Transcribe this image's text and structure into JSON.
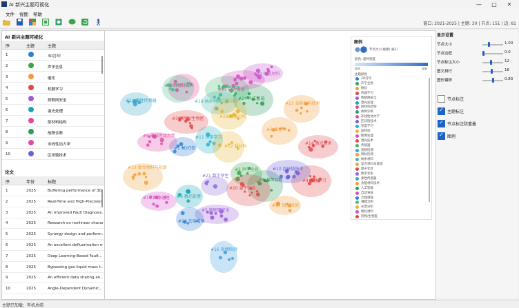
{
  "window": {
    "title": "AI 新兴主题可视化",
    "controls": {
      "minimize": "—",
      "maximize": "□",
      "close": "✕"
    }
  },
  "menu": [
    "文件",
    "视图",
    "帮助"
  ],
  "toolbar": {
    "status": "窗口: 2021-2025 | 主题: 30 | 节点: 151 | 边: 81"
  },
  "topics_panel": {
    "title": "AI 新兴主题可视化",
    "headers": [
      "序",
      "主题",
      "主题"
    ],
    "rows": [
      {
        "id": "1",
        "color": "#2f7fd4",
        "label": "3D打印"
      },
      {
        "id": "2",
        "color": "#3aa64b",
        "label": "声学全息"
      },
      {
        "id": "3",
        "color": "#f29b38",
        "label": "催化"
      },
      {
        "id": "4",
        "color": "#e04848",
        "label": "机器学习"
      },
      {
        "id": "5",
        "color": "#9a5ed6",
        "label": "物联网安全"
      },
      {
        "id": "6",
        "color": "#1aa6b8",
        "label": "激光处理"
      },
      {
        "id": "7",
        "color": "#e8439a",
        "label": "耐材料结构"
      },
      {
        "id": "8",
        "color": "#2a9d59",
        "label": "故障诊断"
      },
      {
        "id": "9",
        "color": "#e04ca8",
        "label": "非线性动力学"
      },
      {
        "id": "10",
        "color": "#6b62d8",
        "label": "区块链技术"
      }
    ]
  },
  "papers_panel": {
    "title": "论文",
    "headers": [
      "序",
      "年份",
      "标题"
    ],
    "rows": [
      {
        "id": "1",
        "year": "2025",
        "title": "Buffering performance of 3D..."
      },
      {
        "id": "2",
        "year": "2025",
        "title": "Real-Time and High-Precision..."
      },
      {
        "id": "3",
        "year": "2025",
        "title": "An Improved Fault Diagnosis..."
      },
      {
        "id": "4",
        "year": "2025",
        "title": "Research on nonlinear charac..."
      },
      {
        "id": "5",
        "year": "2025",
        "title": "Synergy design and perform..."
      },
      {
        "id": "6",
        "year": "2025",
        "title": "An excellent defluorination m..."
      },
      {
        "id": "7",
        "year": "2025",
        "title": "Deep Learning-Based Fault..."
      },
      {
        "id": "8",
        "year": "2025",
        "title": "Bypassing gas-liquid mass t..."
      },
      {
        "id": "9",
        "year": "2025",
        "title": "An efficient data sharing an..."
      },
      {
        "id": "10",
        "year": "2025",
        "title": "Angle-Dependent Dynamic..."
      }
    ]
  },
  "graph": {
    "clusters": [
      {
        "label": "#1 3D打印",
        "color": "#2f7fd4"
      },
      {
        "label": "#2 声学全息",
        "color": "#3aa64b"
      },
      {
        "label": "#3 催化",
        "color": "#f29b38"
      },
      {
        "label": "#4 机器学习",
        "color": "#e04848"
      },
      {
        "label": "#5 物联网安全",
        "color": "#9a5ed6"
      },
      {
        "label": "#6 激光处理",
        "color": "#1aa6b8"
      },
      {
        "label": "#7 耐材料结构",
        "color": "#e8439a"
      },
      {
        "label": "#8 故障诊断",
        "color": "#2a9d59"
      },
      {
        "label": "#9 非线性动力学",
        "color": "#e04ca8"
      },
      {
        "label": "#10 区块链技术",
        "color": "#6b62d8"
      },
      {
        "label": "#11 深度学习",
        "color": "#29b3c9"
      },
      {
        "label": "#12 超材料",
        "color": "#e6b22e"
      },
      {
        "label": "#13 图像处理",
        "color": "#d64fc1"
      },
      {
        "label": "#14 激光技术",
        "color": "#e0474f"
      },
      {
        "label": "#15 传感器",
        "color": "#44b96a"
      },
      {
        "label": "#16 视频检测",
        "color": "#3c9fe0"
      },
      {
        "label": "#17 目标检测",
        "color": "#f29b38"
      },
      {
        "label": "#18 纳米材料",
        "color": "#4db6ac"
      },
      {
        "label": "#19 复合材料与能源",
        "color": "#f2a33a"
      },
      {
        "label": "#20 量子化合",
        "color": "#e04848"
      },
      {
        "label": "#21 数字孪生",
        "color": "#8c6bd6"
      },
      {
        "label": "#22 柔性传感器",
        "color": "#3aa6c8"
      },
      {
        "label": "#23 含能材料技术",
        "color": "#f29b38"
      },
      {
        "label": "#24 人工智能",
        "color": "#2a9d59"
      },
      {
        "label": "#25 自动驾驶",
        "color": "#d64fc1"
      },
      {
        "label": "#26 云端增强",
        "color": "#2f7fd4"
      },
      {
        "label": "#27 薄膜沉积",
        "color": "#3fbf8f"
      },
      {
        "label": "#28 光谱分析",
        "color": "#e6b22e"
      },
      {
        "label": "#29 催化材料",
        "color": "#c554c8"
      },
      {
        "label": "#30 药物/生物医",
        "color": "#e04848"
      }
    ],
    "legend": {
      "title": "图例",
      "size_label": "节点大小(规模) 被引",
      "color_label": "颜色: 超时程度",
      "gradient_left": "较低",
      "gradient_right": "较高",
      "topics_title": "主题颜色",
      "items": [
        {
          "label": "3D打印",
          "color": "#2f7fd4"
        },
        {
          "label": "声学全息",
          "color": "#3aa64b"
        },
        {
          "label": "催化",
          "color": "#f29b38"
        },
        {
          "label": "机器学习",
          "color": "#e04848"
        },
        {
          "label": "物联网安全",
          "color": "#9a5ed6"
        },
        {
          "label": "激光处理",
          "color": "#1aa6b8"
        },
        {
          "label": "耐材料结构",
          "color": "#e8439a"
        },
        {
          "label": "故障诊断",
          "color": "#2a9d59"
        },
        {
          "label": "非线性动力学",
          "color": "#e04ca8"
        },
        {
          "label": "区块链技术",
          "color": "#6b62d8"
        },
        {
          "label": "深度学习",
          "color": "#29b3c9"
        },
        {
          "label": "超材料",
          "color": "#e6b22e"
        },
        {
          "label": "图像处理",
          "color": "#d64fc1"
        },
        {
          "label": "激光技术",
          "color": "#e0474f"
        },
        {
          "label": "传感器",
          "color": "#44b96a"
        },
        {
          "label": "视频检测",
          "color": "#3c9fe0"
        },
        {
          "label": "目标检测",
          "color": "#f29b38"
        },
        {
          "label": "纳米材料",
          "color": "#4db6ac"
        },
        {
          "label": "复合材料与能源",
          "color": "#f2a33a"
        },
        {
          "label": "量子化合",
          "color": "#e04848"
        },
        {
          "label": "数字孪生",
          "color": "#8c6bd6"
        },
        {
          "label": "柔性传感器",
          "color": "#3aa6c8"
        },
        {
          "label": "含能材料技术",
          "color": "#f29b38"
        },
        {
          "label": "人工智能",
          "color": "#2a9d59"
        },
        {
          "label": "自动驾驶",
          "color": "#d64fc1"
        },
        {
          "label": "云端增强",
          "color": "#2f7fd4"
        },
        {
          "label": "薄膜沉积",
          "color": "#3fbf8f"
        },
        {
          "label": "光谱分析",
          "color": "#e6b22e"
        },
        {
          "label": "催化材料",
          "color": "#c554c8"
        },
        {
          "label": "药物/生物医",
          "color": "#e04848"
        }
      ]
    }
  },
  "display_settings": {
    "title": "显示设置",
    "sliders": [
      {
        "label": "节点大小",
        "value": "1.00",
        "fraction": 0.3
      },
      {
        "label": "节点边框",
        "value": "0.0",
        "fraction": 0.0
      },
      {
        "label": "节点标注大小",
        "value": "12",
        "fraction": 0.4
      },
      {
        "label": "图文排行",
        "value": "18",
        "fraction": 0.45
      },
      {
        "label": "图形偏移",
        "value": "0.83",
        "fraction": 0.5
      }
    ],
    "checks": [
      {
        "label": "节点标注",
        "checked": false
      },
      {
        "label": "主题标注",
        "checked": true
      },
      {
        "label": "节点标注防重叠",
        "checked": true
      },
      {
        "label": "图例",
        "checked": true
      }
    ]
  },
  "statusbar": {
    "text": "主题已加载：有机总结"
  }
}
